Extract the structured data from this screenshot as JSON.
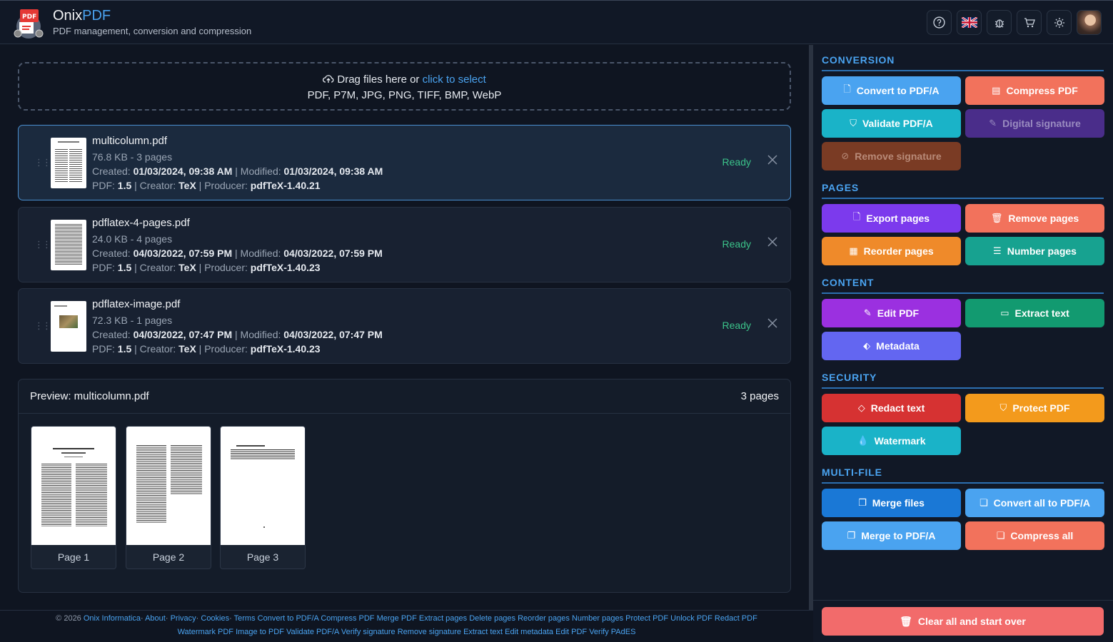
{
  "header": {
    "brand_main": "Onix",
    "brand_accent": "PDF",
    "tagline": "PDF management, conversion and compression",
    "icons": [
      "help-icon",
      "uk-flag-icon",
      "bug-icon",
      "cart-icon",
      "sun-icon",
      "user-avatar"
    ]
  },
  "dropzone": {
    "text_prefix": "Drag files here or ",
    "link": "click to select",
    "formats": "PDF, P7M, JPG, PNG, TIFF, BMP, WebP"
  },
  "files": [
    {
      "name": "multicolumn.pdf",
      "size": "76.8 KB - 3 pages",
      "created_label": "Created:",
      "created": "01/03/2024, 09:38 AM",
      "modified_label": "| Modified:",
      "modified": "01/03/2024, 09:38 AM",
      "pdf_label": "PDF:",
      "pdf": "1.5",
      "creator_label": "| Creator:",
      "creator": "TeX",
      "producer_label": "| Producer:",
      "producer": "pdfTeX-1.40.21",
      "status": "Ready"
    },
    {
      "name": "pdflatex-4-pages.pdf",
      "size": "24.0 KB - 4 pages",
      "created_label": "Created:",
      "created": "04/03/2022, 07:59 PM",
      "modified_label": "| Modified:",
      "modified": "04/03/2022, 07:59 PM",
      "pdf_label": "PDF:",
      "pdf": "1.5",
      "creator_label": "| Creator:",
      "creator": "TeX",
      "producer_label": "| Producer:",
      "producer": "pdfTeX-1.40.23",
      "status": "Ready"
    },
    {
      "name": "pdflatex-image.pdf",
      "size": "72.3 KB - 1 pages",
      "created_label": "Created:",
      "created": "04/03/2022, 07:47 PM",
      "modified_label": "| Modified:",
      "modified": "04/03/2022, 07:47 PM",
      "pdf_label": "PDF:",
      "pdf": "1.5",
      "creator_label": "| Creator:",
      "creator": "TeX",
      "producer_label": "| Producer:",
      "producer": "pdfTeX-1.40.23",
      "status": "Ready"
    }
  ],
  "preview": {
    "title": "Preview: multicolumn.pdf",
    "count": "3 pages",
    "pages": [
      "Page 1",
      "Page 2",
      "Page 3"
    ]
  },
  "sidebar": {
    "sections": {
      "conversion": "CONVERSION",
      "pages": "PAGES",
      "content": "CONTENT",
      "security": "SECURITY",
      "multi": "MULTI-FILE"
    },
    "buttons": {
      "convert_pdfa": "Convert to PDF/A",
      "compress_pdf": "Compress PDF",
      "validate_pdfa": "Validate PDF/A",
      "digital_signature": "Digital signature",
      "remove_signature": "Remove signature",
      "export_pages": "Export pages",
      "remove_pages": "Remove pages",
      "reorder_pages": "Reorder pages",
      "number_pages": "Number pages",
      "edit_pdf": "Edit PDF",
      "extract_text": "Extract text",
      "metadata": "Metadata",
      "redact_text": "Redact text",
      "protect_pdf": "Protect PDF",
      "watermark": "Watermark",
      "merge_files": "Merge files",
      "convert_all": "Convert all to PDF/A",
      "merge_pdfa": "Merge to PDF/A",
      "compress_all": "Compress all",
      "clear_all": "Clear all and start over"
    },
    "colors": {
      "blue_light": "#4aa3f0",
      "salmon": "#f2725c",
      "cyan": "#1ab3c8",
      "purple_dark": "#4a2d8a",
      "brown": "#7a3b24",
      "violet": "#7c3aed",
      "orange": "#ef8a2a",
      "teal": "#17a290",
      "magenta": "#9b30e0",
      "green": "#129a70",
      "indigo": "#6366f1",
      "red": "#d63232",
      "amber": "#f39a1c",
      "blue": "#1a78d6",
      "red_light": "#f26b6b"
    }
  },
  "footer": {
    "copyright": "© 2026 ",
    "links_row1": [
      "Onix Informatica",
      "About",
      "Privacy",
      "Cookies",
      "Terms",
      "Convert to PDF/A",
      "Compress PDF",
      "Merge PDF",
      "Extract pages",
      "Delete pages",
      "Reorder pages",
      "Number pages",
      "Protect PDF",
      "Unlock PDF",
      "Redact PDF"
    ],
    "links_row2": [
      "Watermark PDF",
      "Image to PDF",
      "Validate PDF/A",
      "Verify signature",
      "Remove signature",
      "Extract text",
      "Edit metadata",
      "Edit PDF",
      "Verify PAdES"
    ]
  }
}
